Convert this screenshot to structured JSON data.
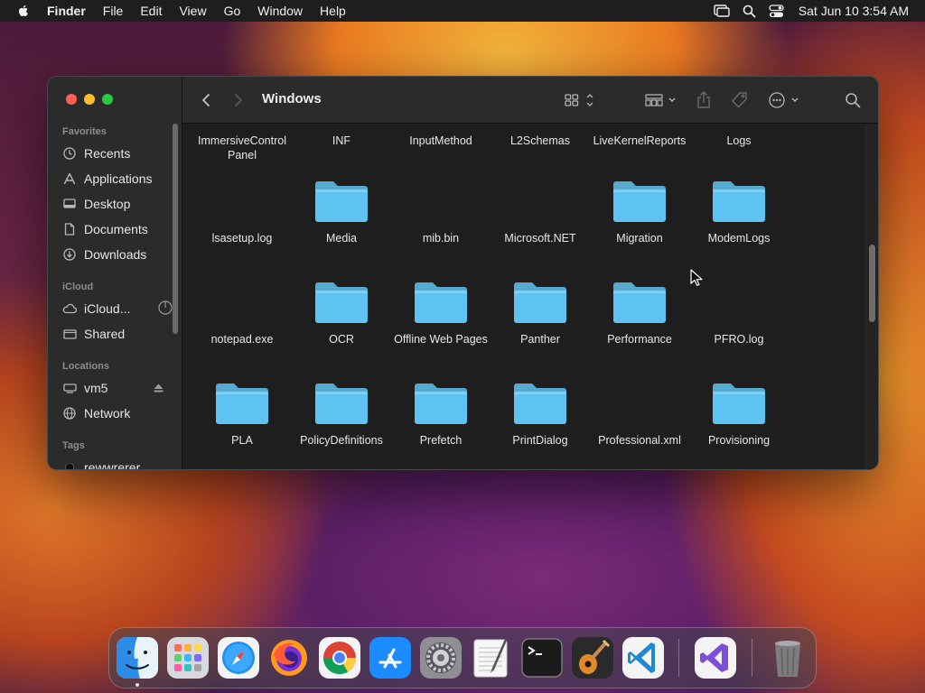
{
  "menubar": {
    "items": [
      "Finder",
      "File",
      "Edit",
      "View",
      "Go",
      "Window",
      "Help"
    ],
    "clock": "Sat Jun 10  3:54 AM"
  },
  "window": {
    "title": "Windows"
  },
  "sidebar": {
    "sections": {
      "favorites": "Favorites",
      "icloud": "iCloud",
      "locations": "Locations",
      "tags": "Tags"
    },
    "favorites": [
      "Recents",
      "Applications",
      "Desktop",
      "Documents",
      "Downloads"
    ],
    "icloud": [
      "iCloud...",
      "Shared"
    ],
    "locations": [
      "vm5",
      "Network"
    ],
    "tags": [
      "rewwrerer"
    ]
  },
  "files": [
    {
      "name": "ImmersiveControl Panel",
      "kind": "none"
    },
    {
      "name": "INF",
      "kind": "none"
    },
    {
      "name": "InputMethod",
      "kind": "none"
    },
    {
      "name": "L2Schemas",
      "kind": "none"
    },
    {
      "name": "LiveKernelReports",
      "kind": "none"
    },
    {
      "name": "Logs",
      "kind": "none"
    },
    {
      "name": "lsasetup.log",
      "kind": "file"
    },
    {
      "name": "Media",
      "kind": "folder"
    },
    {
      "name": "mib.bin",
      "kind": "file"
    },
    {
      "name": "Microsoft.NET",
      "kind": "file"
    },
    {
      "name": "Migration",
      "kind": "folder"
    },
    {
      "name": "ModemLogs",
      "kind": "folder"
    },
    {
      "name": "notepad.exe",
      "kind": "file"
    },
    {
      "name": "OCR",
      "kind": "folder"
    },
    {
      "name": "Offline Web Pages",
      "kind": "folder"
    },
    {
      "name": "Panther",
      "kind": "folder"
    },
    {
      "name": "Performance",
      "kind": "folder"
    },
    {
      "name": "PFRO.log",
      "kind": "file"
    },
    {
      "name": "PLA",
      "kind": "folder"
    },
    {
      "name": "PolicyDefinitions",
      "kind": "folder"
    },
    {
      "name": "Prefetch",
      "kind": "folder"
    },
    {
      "name": "PrintDialog",
      "kind": "folder"
    },
    {
      "name": "Professional.xml",
      "kind": "file"
    },
    {
      "name": "Provisioning",
      "kind": "folder"
    }
  ],
  "dock": [
    "finder-icon",
    "launchpad-icon",
    "safari-icon",
    "firefox-icon",
    "chrome-icon",
    "app-store-icon",
    "system-settings-icon",
    "textedit-icon",
    "terminal-icon",
    "garageband-icon",
    "vscode-icon",
    "visual-studio-icon",
    "trash-icon"
  ],
  "colors": {
    "folder": "#5ec3f0",
    "close": "#ff5f57",
    "minimize": "#febc2e",
    "maximize": "#28c840"
  }
}
